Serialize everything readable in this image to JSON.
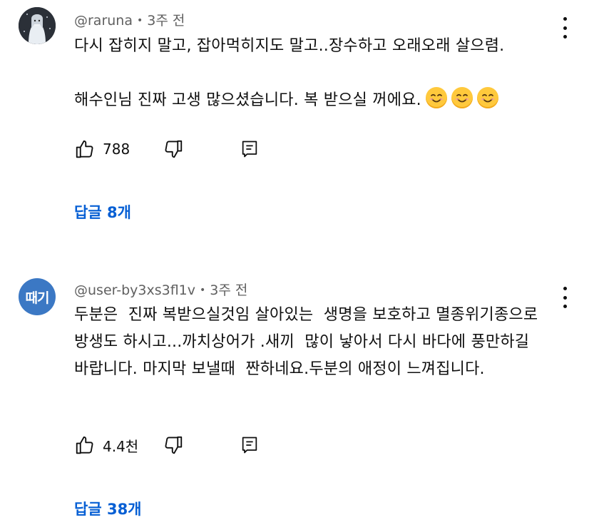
{
  "comments": [
    {
      "avatar_icon": "user-avatar-icon",
      "username": "@raruna",
      "time": "3주 전",
      "text": "다시 잡히지 말고, 잡아먹히지도 말고..장수하고 오래오래 살으렴.\n\n해수인님 진짜 고생 많으셨습니다. 복 받으실 꺼에요.",
      "emojis": [
        "smiling-face-icon",
        "smiling-face-icon",
        "smiling-face-icon"
      ],
      "likes": "788",
      "replies_label": "답글 8개"
    },
    {
      "avatar_text": "때기",
      "avatar_color": "#3b78c4",
      "username": "@user-by3xs3fl1v",
      "time": "3주 전",
      "text": "두분은  진짜 복받으실것임 살아있는  생명을 보호하고 멸종위기종으로 방생도 하시고...까치상어가 .새끼  많이 낳아서 다시 바다에 풍만하길 바랍니다. 마지막 보낼때  짠하네요.두분의 애정이 느껴집니다.",
      "likes": "4.4천",
      "replies_label": "답글 38개"
    }
  ],
  "colors": {
    "reply_link": "#065fd4",
    "meta_text": "#606060",
    "primary_text": "#0f0f0f"
  }
}
